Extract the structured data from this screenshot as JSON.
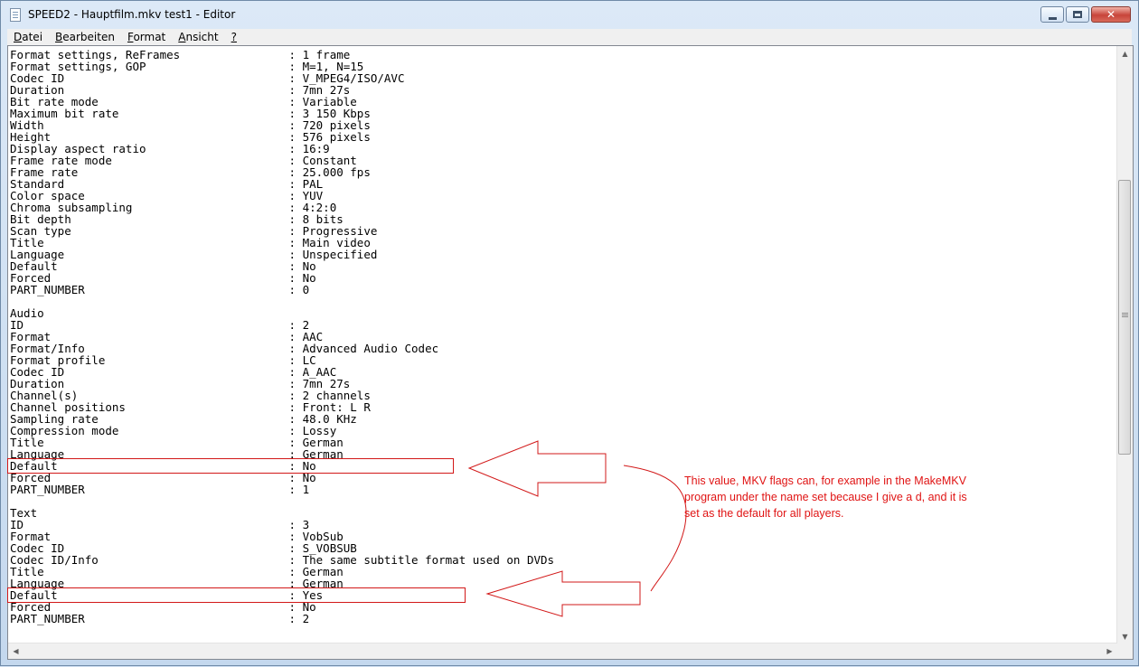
{
  "window": {
    "title": "SPEED2 - Hauptfilm.mkv test1 - Editor",
    "buttons": {
      "minimize": "minimize",
      "maximize": "maximize",
      "close": "✕"
    }
  },
  "menu": [
    {
      "accel": "D",
      "rest": "atei"
    },
    {
      "accel": "B",
      "rest": "earbeiten"
    },
    {
      "accel": "F",
      "rest": "ormat"
    },
    {
      "accel": "A",
      "rest": "nsicht"
    },
    {
      "accel": "?",
      "rest": ""
    }
  ],
  "lines": [
    "Format settings, ReFrames                : 1 frame",
    "Format settings, GOP                     : M=1, N=15",
    "Codec ID                                 : V_MPEG4/ISO/AVC",
    "Duration                                 : 7mn 27s",
    "Bit rate mode                            : Variable",
    "Maximum bit rate                         : 3 150 Kbps",
    "Width                                    : 720 pixels",
    "Height                                   : 576 pixels",
    "Display aspect ratio                     : 16:9",
    "Frame rate mode                          : Constant",
    "Frame rate                               : 25.000 fps",
    "Standard                                 : PAL",
    "Color space                              : YUV",
    "Chroma subsampling                       : 4:2:0",
    "Bit depth                                : 8 bits",
    "Scan type                                : Progressive",
    "Title                                    : Main video",
    "Language                                 : Unspecified",
    "Default                                  : No",
    "Forced                                   : No",
    "PART_NUMBER                              : 0",
    "",
    "Audio",
    "ID                                       : 2",
    "Format                                   : AAC",
    "Format/Info                              : Advanced Audio Codec",
    "Format profile                           : LC",
    "Codec ID                                 : A_AAC",
    "Duration                                 : 7mn 27s",
    "Channel(s)                               : 2 channels",
    "Channel positions                        : Front: L R",
    "Sampling rate                            : 48.0 KHz",
    "Compression mode                         : Lossy",
    "Title                                    : German",
    "Language                                 : German",
    "Default                                  : No",
    "Forced                                   : No",
    "PART_NUMBER                              : 1",
    "",
    "Text",
    "ID                                       : 3",
    "Format                                   : VobSub",
    "Codec ID                                 : S_VOBSUB",
    "Codec ID/Info                            : The same subtitle format used on DVDs",
    "Title                                    : German",
    "Language                                 : German",
    "Default                                  : Yes",
    "Forced                                   : No",
    "PART_NUMBER                              : 2"
  ],
  "annotation": "This value, MKV flags can, for example in the MakeMKV program under the name set because I give a d, and it is set as the default for all players.",
  "colors": {
    "annotation": "#e01414"
  },
  "icons": {
    "app": "notepad-icon",
    "scroll_up": "arrow-up-icon",
    "scroll_down": "arrow-down-icon",
    "scroll_left": "arrow-left-icon",
    "scroll_right": "arrow-right-icon"
  }
}
